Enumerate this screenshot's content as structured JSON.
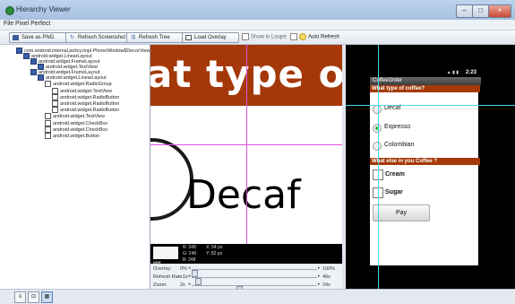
{
  "window": {
    "title": "Hierarchy Viewer",
    "minimize": "–",
    "maximize": "□",
    "close": "×"
  },
  "menu": [
    "File",
    "Pixel Perfect"
  ],
  "toolbar": {
    "save_png": "Save as PNG",
    "refresh_screenshot": "Refresh Screenshot",
    "refresh_tree": "Refresh Tree",
    "load_overlay": "Load Overlay",
    "show_in_loupe": "Show in Loupe",
    "auto_refresh": "Auto Refresh",
    "icons": {
      "save": "floppy-icon",
      "refresh_screenshot": "refresh-icon",
      "refresh_tree": "tree-icon",
      "load_overlay": "overlay-icon"
    }
  },
  "tree": [
    {
      "label": "com.android.internal.policy.impl.PhoneWindow$DecorView",
      "level": 0
    },
    {
      "label": "android.widget.LinearLayout",
      "level": 1
    },
    {
      "label": "android.widget.FrameLayout",
      "level": 2
    },
    {
      "label": "android.widget.TextView",
      "level": 3
    },
    {
      "label": "android.widget.FrameLayout",
      "level": 2
    },
    {
      "label": "android.widget.LinearLayout",
      "level": 3
    },
    {
      "label": "android.widget.RadioGroup",
      "level": 4
    },
    {
      "label": "android.widget.TextView",
      "level": 5
    },
    {
      "label": "android.widget.RadioButton",
      "level": 5
    },
    {
      "label": "android.widget.RadioButton",
      "level": 5
    },
    {
      "label": "android.widget.RadioButton",
      "level": 5
    },
    {
      "label": "android.widget.TextView",
      "level": 4
    },
    {
      "label": "android.widget.CheckBox",
      "level": 4
    },
    {
      "label": "android.widget.CheckBox",
      "level": 4
    },
    {
      "label": "android.widget.Button",
      "level": 4
    }
  ],
  "loupe": {
    "header_text": "at type of",
    "body_text": "Decaf"
  },
  "pixel_info": {
    "swatch_color": "#f5f5f5",
    "hex": "#ffffff",
    "r": "R: 248",
    "g": "G: 248",
    "b": "B: 248",
    "x": "X: 54 px",
    "y": "Y: 82 px"
  },
  "controls": {
    "overlay": {
      "label": "Overlay:",
      "value": "0%",
      "max": "100%",
      "level": 0
    },
    "refresh_rate": {
      "label": "Refresh Rate:",
      "value": "1s",
      "max": "40s",
      "level": 0.03
    },
    "zoom": {
      "label": "Zoom:",
      "value": "2x",
      "max": "24x",
      "level": 0.37
    }
  },
  "phone": {
    "status_icons": "▲ ▮ ▮",
    "time": "2:23",
    "app_title": "CoffeeOrder",
    "section1": "What type of coffee?",
    "options": [
      {
        "label": "Decaf",
        "checked": false
      },
      {
        "label": "Expresso",
        "checked": true
      },
      {
        "label": "Colombian",
        "checked": false
      }
    ],
    "section2": "What else in you Coffee ?",
    "extras": [
      "Cream",
      "Sugar"
    ],
    "pay": "Pay"
  },
  "colors": {
    "accent_header": "#a43808",
    "crosshair": "#e055e0",
    "phone_guide": "#4ad8e8"
  },
  "bottombar": {
    "icons": [
      "tree-view-icon",
      "pixel-perfect-icon",
      "grid-icon"
    ]
  }
}
